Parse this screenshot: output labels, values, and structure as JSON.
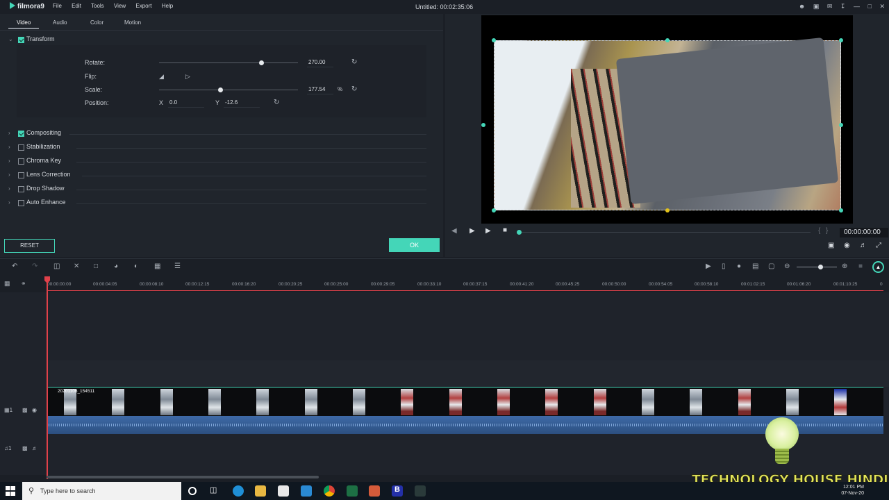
{
  "app": {
    "name": "filmora9",
    "doc_title": "Untitled:",
    "doc_duration": "00:02:35:06"
  },
  "menu": [
    "File",
    "Edit",
    "Tools",
    "View",
    "Export",
    "Help"
  ],
  "tabs": [
    {
      "label": "Video"
    },
    {
      "label": "Audio"
    },
    {
      "label": "Color"
    },
    {
      "label": "Motion"
    }
  ],
  "transform": {
    "label": "Transform",
    "rotate_label": "Rotate:",
    "rotate_value": "270.00",
    "flip_label": "Flip:",
    "scale_label": "Scale:",
    "scale_value": "177.54",
    "scale_unit": "%",
    "position_label": "Position:",
    "x_label": "X",
    "x_value": "0.0",
    "y_label": "Y",
    "y_value": "-12.6"
  },
  "sections": [
    {
      "label": "Compositing",
      "checked": true
    },
    {
      "label": "Stabilization",
      "checked": false
    },
    {
      "label": "Chroma Key",
      "checked": false
    },
    {
      "label": "Lens Correction",
      "checked": false
    },
    {
      "label": "Drop Shadow",
      "checked": false
    },
    {
      "label": "Auto Enhance",
      "checked": false
    }
  ],
  "buttons": {
    "reset": "RESET",
    "ok": "OK"
  },
  "preview": {
    "timecode": "00:00:00:00"
  },
  "ruler": [
    "00:00:00:00",
    "00:00:04:05",
    "00:00:08:10",
    "00:00:12:15",
    "00:00:16:20",
    "00:00:20:25",
    "00:00:25:00",
    "00:00:29:05",
    "00:00:33:10",
    "00:00:37:15",
    "00:00:41:20",
    "00:00:45:25",
    "00:00:50:00",
    "00:00:54:05",
    "00:00:58:10",
    "00:01:02:15",
    "00:01:06:20",
    "00:01:10:25",
    "0"
  ],
  "clip": {
    "name": "20201106_154511"
  },
  "track_labels": {
    "video": "1",
    "audio": "1"
  },
  "watermark": "TECHNOLOGY HOUSE HINDI",
  "taskbar": {
    "search_placeholder": "Type here to search",
    "time": "12:01 PM",
    "date": "07-Nov-20"
  },
  "colors": {
    "accent": "#44d6b8",
    "playhead": "#e0414a",
    "audio": "#3e6aa7"
  }
}
